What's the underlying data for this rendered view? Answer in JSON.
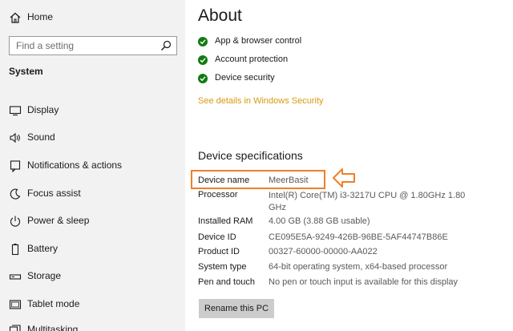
{
  "sidebar": {
    "home_label": "Home",
    "search_placeholder": "Find a setting",
    "section_title": "System",
    "items": [
      {
        "label": "Display",
        "icon": "display-icon"
      },
      {
        "label": "Sound",
        "icon": "sound-icon"
      },
      {
        "label": "Notifications & actions",
        "icon": "notifications-icon"
      },
      {
        "label": "Focus assist",
        "icon": "focus-assist-icon"
      },
      {
        "label": "Power & sleep",
        "icon": "power-icon"
      },
      {
        "label": "Battery",
        "icon": "battery-icon"
      },
      {
        "label": "Storage",
        "icon": "storage-icon"
      },
      {
        "label": "Tablet mode",
        "icon": "tablet-icon"
      },
      {
        "label": "Multitasking",
        "icon": "multitasking-icon"
      }
    ]
  },
  "main": {
    "title": "About",
    "protections": [
      {
        "label": "App & browser control",
        "status_color": "#107c10"
      },
      {
        "label": "Account protection",
        "status_color": "#107c10"
      },
      {
        "label": "Device security",
        "status_color": "#107c10"
      }
    ],
    "security_link": "See details in Windows Security",
    "specs_heading": "Device specifications",
    "specs": [
      {
        "key": "Device name",
        "value": "MeerBasit"
      },
      {
        "key": "Processor",
        "value": "Intel(R) Core(TM) i3-3217U CPU @ 1.80GHz   1.80 GHz"
      },
      {
        "key": "Installed RAM",
        "value": "4.00 GB (3.88 GB usable)"
      },
      {
        "key": "Device ID",
        "value": "CE095E5A-9249-426B-96BE-5AF44747B86E"
      },
      {
        "key": "Product ID",
        "value": "00327-60000-00000-AA022"
      },
      {
        "key": "System type",
        "value": "64-bit operating system, x64-based processor"
      },
      {
        "key": "Pen and touch",
        "value": "No pen or touch input is available for this display"
      }
    ],
    "rename_button": "Rename this PC"
  },
  "colors": {
    "accent_link": "#d89a10",
    "highlight": "#f07f28",
    "check_green": "#107c10",
    "sidebar_bg": "#f2f2f2"
  }
}
